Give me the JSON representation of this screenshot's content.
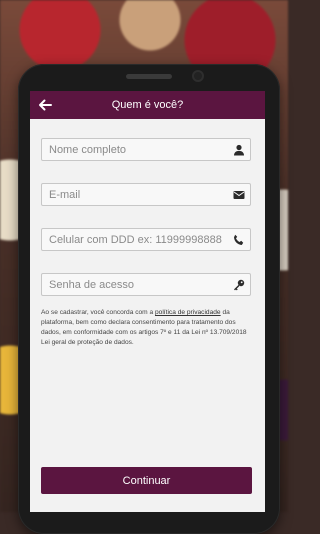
{
  "header": {
    "title": "Quem é você?",
    "back_icon": "back-arrow-icon"
  },
  "form": {
    "name_placeholder": "Nome completo",
    "email_placeholder": "E-mail",
    "phone_placeholder": "Celular com DDD ex: 11999998888",
    "password_placeholder": "Senha de acesso",
    "icons": [
      "person-icon",
      "envelope-icon",
      "phone-icon",
      "key-icon"
    ]
  },
  "legal": {
    "before_link": "Ao se cadastrar, você concorda com a ",
    "link": "política de privacidade",
    "after_link": " da plataforma, bem como declara consentimento para tratamento dos dados, em conformidade com os artigos 7º e 11 da Lei nº 13.709/2018 Lei geral de proteção de dados."
  },
  "actions": {
    "continue_label": "Continuar"
  },
  "colors": {
    "primary": "#5b1540",
    "screen_bg": "#f2f2f2",
    "field_border": "#c7c7c7"
  }
}
